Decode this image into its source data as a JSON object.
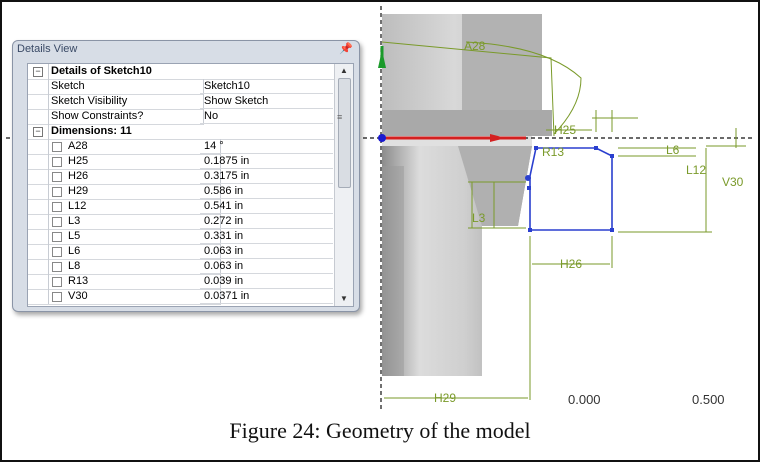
{
  "caption": "Figure 24: Geometry of the model",
  "details_view": {
    "title": "Details View",
    "pin_icon": "pin-icon",
    "header": {
      "label": "Details of Sketch10"
    },
    "rows": [
      {
        "key": "Sketch",
        "value": "Sketch10"
      },
      {
        "key": "Sketch Visibility",
        "value": "Show Sketch"
      },
      {
        "key": "Show Constraints?",
        "value": "No"
      }
    ],
    "dimensions_header": {
      "label": "Dimensions: 11"
    },
    "dimensions": [
      {
        "key": "A28",
        "value": "14 °"
      },
      {
        "key": "H25",
        "value": "0.1875 in"
      },
      {
        "key": "H26",
        "value": "0.3175 in"
      },
      {
        "key": "H29",
        "value": "0.586 in"
      },
      {
        "key": "L12",
        "value": "0.541 in"
      },
      {
        "key": "L3",
        "value": "0.272 in"
      },
      {
        "key": "L5",
        "value": "0.331 in"
      },
      {
        "key": "L6",
        "value": "0.063 in"
      },
      {
        "key": "L8",
        "value": "0.063 in"
      },
      {
        "key": "R13",
        "value": "0.039 in"
      },
      {
        "key": "V30",
        "value": "0.0371 in"
      }
    ]
  },
  "sketch_labels": {
    "a28": "A28",
    "h25": "H25",
    "r13": "R13",
    "l6": "L6",
    "l12": "L12",
    "v30": "V30",
    "l3": "L3",
    "h26": "H26",
    "h29": "H29"
  },
  "scale_ruler": {
    "start": "0.000",
    "end": "0.500"
  },
  "colors": {
    "dimension": "#7a9a2a",
    "sketch_line": "#2a3fcf",
    "axis_x": "#d42020",
    "axis_y": "#1a9a2a",
    "part_gray": "#c8c8c8"
  }
}
